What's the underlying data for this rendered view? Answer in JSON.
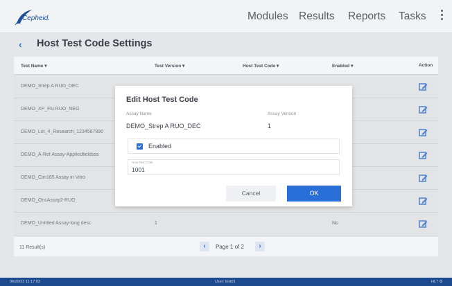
{
  "app": {
    "brand": "Cepheid."
  },
  "nav": {
    "items": [
      "Modules",
      "Results",
      "Reports",
      "Tasks"
    ]
  },
  "page": {
    "title": "Host Test Code Settings"
  },
  "table": {
    "headers": {
      "test_name": "Test Name ▾",
      "test_version": "Test Version ▾",
      "host_code": "Host Test Code ▾",
      "enabled": "Enabled ▾",
      "action": "Action"
    },
    "rows": [
      {
        "name": "DEMO_Strep A RUO_DEC",
        "version": "",
        "enabled": ""
      },
      {
        "name": "DEMO_XP_Flu RUO_NEG",
        "version": "",
        "enabled": ""
      },
      {
        "name": "DEMO_Lot_4_Research_1234567890",
        "version": "",
        "enabled": ""
      },
      {
        "name": "DEMO_A-Ref Assay-Appliedfieldsss",
        "version": "",
        "enabled": ""
      },
      {
        "name": "DEMO_Clin165 Assay in Vitro",
        "version": "",
        "enabled": ""
      },
      {
        "name": "DEMO_OncAssay2-RUO",
        "version": "",
        "enabled": ""
      },
      {
        "name": "DEMO_Untitled Assay-long desc",
        "version": "1",
        "enabled": "No"
      }
    ],
    "result_count": "11 Result(s)",
    "pagination": "Page 1 of 2"
  },
  "dialog": {
    "title": "Edit Host Test Code",
    "assay_name_label": "Assay Name",
    "assay_name": "DEMO_Strep A RUO_DEC",
    "assay_version_label": "Assay Version",
    "assay_version": "1",
    "enabled_label": "Enabled",
    "enabled_checked": true,
    "host_code_placeholder": "Host Test Code",
    "host_code_value": "1001",
    "cancel_label": "Cancel",
    "ok_label": "OK"
  },
  "status": {
    "datetime": "06/20/22 11:17:03",
    "user": "User: test01",
    "level": "HL7 ⚙"
  },
  "colors": {
    "accent": "#2a6fd8",
    "statusbar": "#1d4a8f",
    "brand": "#1c4f9c"
  }
}
